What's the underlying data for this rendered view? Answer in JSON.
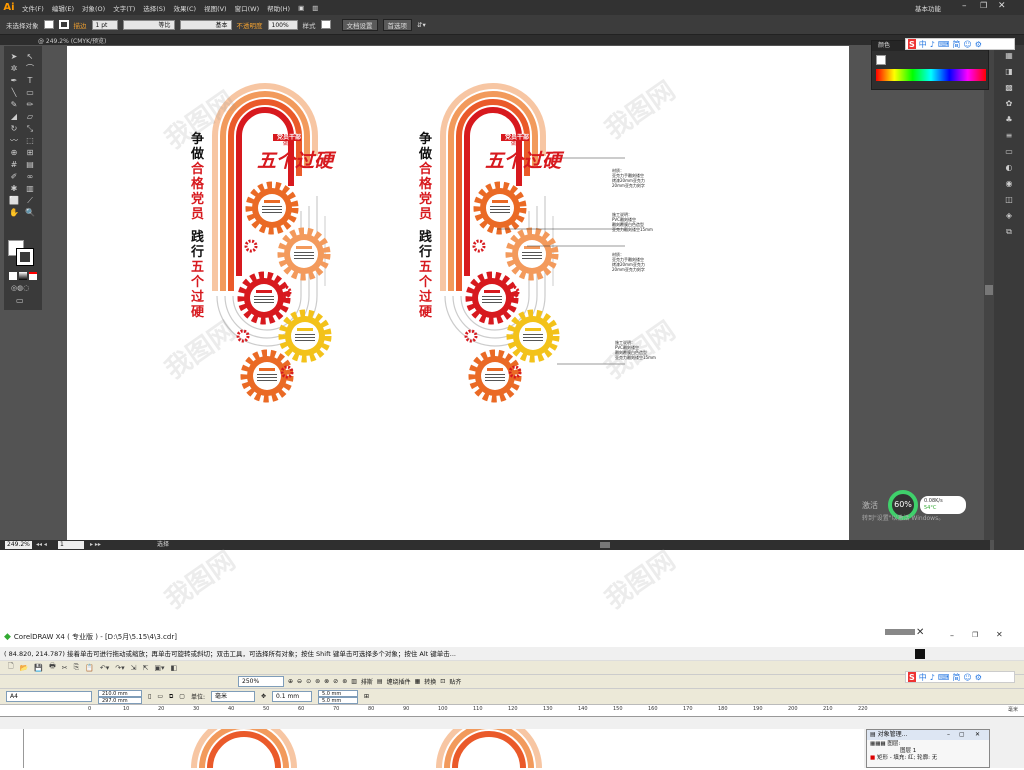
{
  "illustrator": {
    "logo": "Ai",
    "menus": [
      "文件(F)",
      "编辑(E)",
      "对象(O)",
      "文字(T)",
      "选择(S)",
      "效果(C)",
      "视图(V)",
      "窗口(W)",
      "帮助(H)"
    ],
    "workspace": "基本功能",
    "control": {
      "selection": "未选择对象",
      "stroke_label": "描边",
      "stroke_weight": "1 pt",
      "profile1": "等比",
      "profile2": "基本",
      "opacity_label": "不透明度",
      "opacity": "100%",
      "style_label": "样式",
      "doc_setup": "文档设置",
      "prefs": "首选项"
    },
    "doc_tab": "@ 249.2% (CMYK/预览)",
    "zoom": "249.2%",
    "artboard": "1",
    "status": "选择",
    "color_panel_tab": "颜色",
    "netstat": {
      "percent": "60%",
      "speed": "0.08K/s",
      "temp": "54°C"
    },
    "activate": [
      "激活",
      "转到\"设置\"以激活 Windows。"
    ],
    "art": {
      "banner": "党员干部",
      "banner_sub": "做到",
      "title": "五个过硬",
      "vert1": [
        "争",
        "做",
        "合",
        "格",
        "党",
        "员"
      ],
      "vert2": [
        "践",
        "行",
        "五",
        "个",
        "过",
        "硬"
      ],
      "annot": [
        {
          "head": "材质：",
          "lines": [
            "亚克力手雕刻镂空",
            "烤漆20mm亚克力",
            "20mm亚克力刻字"
          ]
        },
        {
          "head": "施工说明：",
          "lines": [
            "PVC雕刻镂空",
            "雕刻覆膜白色造型",
            "亚克力雕刻镂空15mm"
          ]
        },
        {
          "head": "材质：",
          "lines": [
            "亚克力手雕刻镂空",
            "烤漆20mm亚克力",
            "20mm亚克力刻字"
          ]
        },
        {
          "head": "施工说明：",
          "lines": [
            "PVC雕刻镂空",
            "雕刻覆膜白色造型",
            "亚克力雕刻镂空15mm"
          ]
        }
      ]
    }
  },
  "coreldraw": {
    "title": "CorelDRAW X4 ( 专业版 ) - [D:\\5月\\5.15\\4\\3.cdr]",
    "status": "( 84.820, 214.787)    接着单击可进行拖动或缩放；再单击可旋转或斜切；双击工具，可选择所有对象；按住 Shift 键单击可选择多个对象；按住 Alt 键单击...",
    "zoom": "250%",
    "tb_labels": [
      "排斯",
      "缠绕插件",
      "转换",
      "贴齐"
    ],
    "paper": "A4",
    "width": "210.0 mm",
    "height": "297.0 mm",
    "unit_label": "单位:",
    "unit": "毫米",
    "nudge": "0.1 mm",
    "dup_x": "5.0 mm",
    "dup_y": "5.0 mm",
    "ruler": [
      "0",
      "10",
      "20",
      "30",
      "40",
      "50",
      "60",
      "70",
      "80",
      "90",
      "100",
      "110",
      "120",
      "130",
      "140",
      "150",
      "160",
      "170",
      "180",
      "190",
      "200",
      "210",
      "220"
    ],
    "ruler_unit": "毫米",
    "objmgr": {
      "title": "对象管理...",
      "items": [
        "图层:",
        "图层 1"
      ],
      "row": "矩形 - 填充: 红; 轮廓: 无"
    }
  },
  "sogou": {
    "items": [
      "中",
      "♪",
      "⌨",
      "简",
      "☺",
      "⚙"
    ]
  }
}
